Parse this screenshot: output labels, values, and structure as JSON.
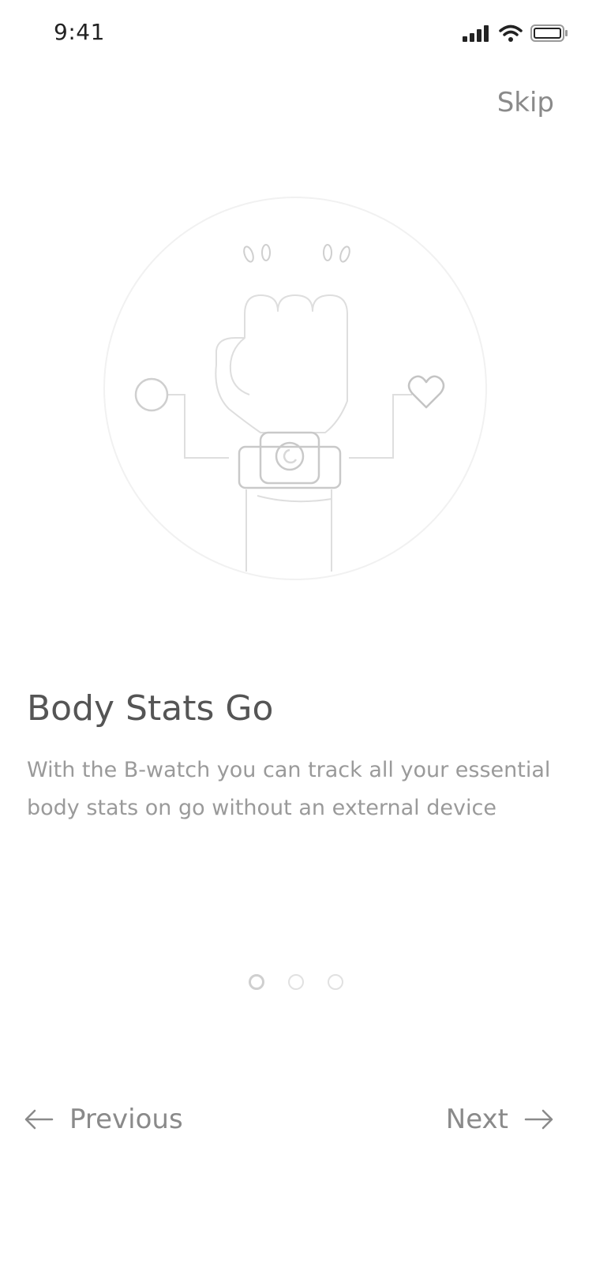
{
  "status_bar": {
    "time": "9:41"
  },
  "header": {
    "skip_label": "Skip"
  },
  "illustration": {
    "icon_name": "watch-hand-illustration"
  },
  "content": {
    "title": "Body Stats Go",
    "description": "With the B-watch you can track all your essential body stats on go without an external device"
  },
  "pagination": {
    "total": 3,
    "current": 1
  },
  "navigation": {
    "previous_label": "Previous",
    "next_label": "Next"
  }
}
